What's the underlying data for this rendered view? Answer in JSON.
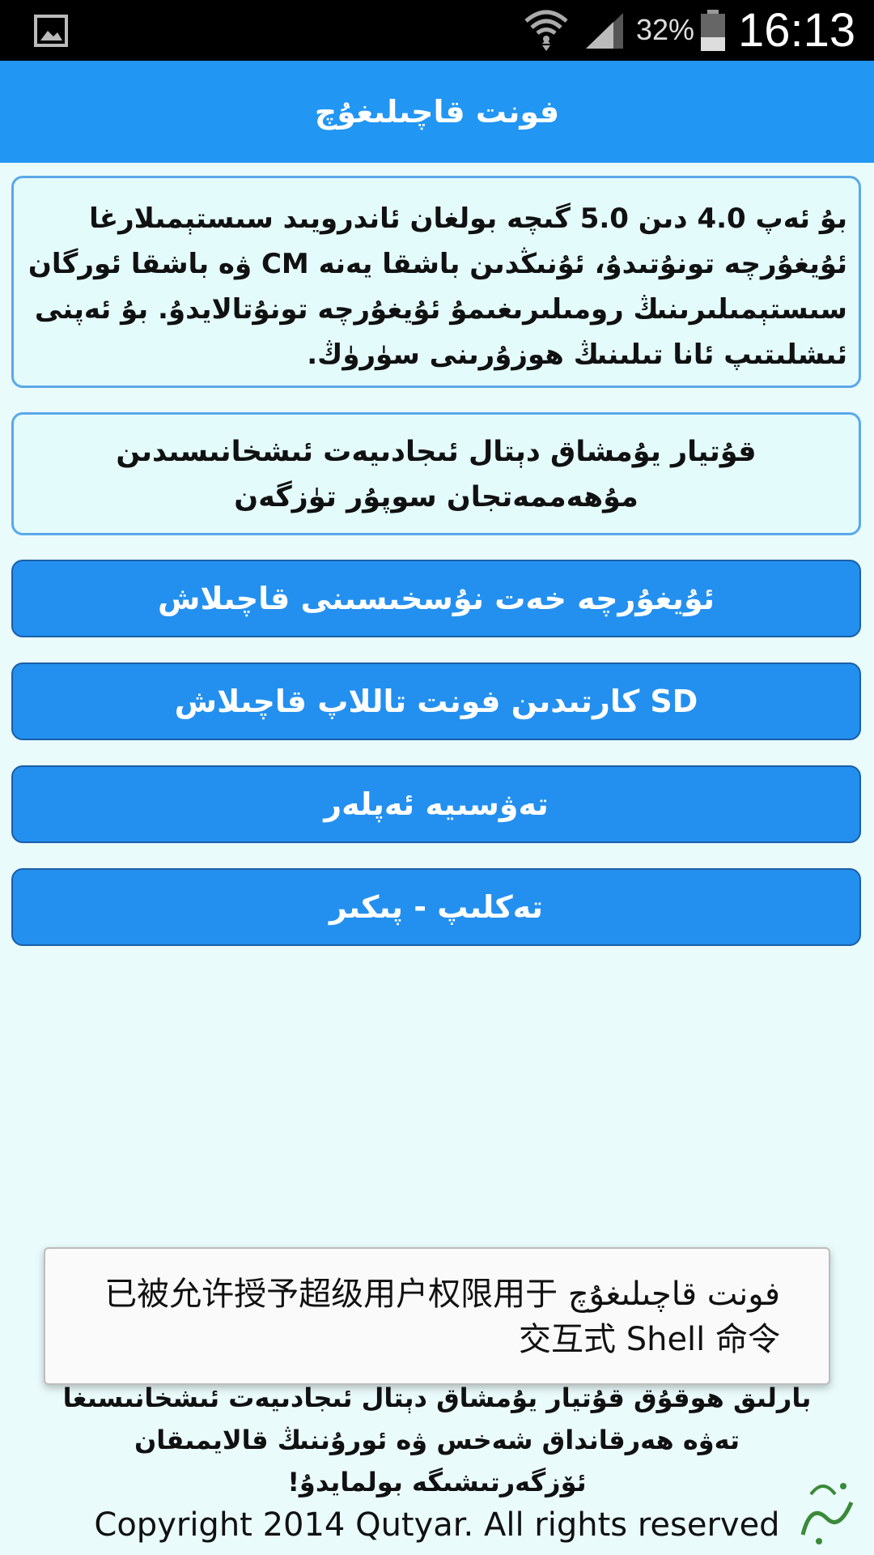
{
  "status_bar": {
    "battery_percent": "32%",
    "time": "16:13",
    "icons": [
      "gallery-icon",
      "wifi-icon",
      "signal-icon",
      "battery-icon"
    ]
  },
  "app_bar": {
    "title": "فونت قاچىلىغۇچ"
  },
  "description": "بۇ ئەپ 4.0 دىن 5.0 گىچە بولغان ئاندرويىد سىستېمىلارغا ئۇيغۇرچە تونۇتىدۇ، ئۇنىڭدىن باشقا يەنە CM ۋە باشقا ئورگان سىستېمىلىرىنىڭ رومىلىرىغىمۇ ئۇيغۇرچە تونۇتالايدۇ. بۇ ئەپنى ئىشلىتىپ ئانا تىلىنىڭ ھوزۇرىنى سۈرۈڭ.",
  "author_note": "قۇتيار يۇمشاق دېتال ئىجادىيەت ئىشخانىسىدىن مۇھەممەتجان سوپۇر تۈزگەن",
  "buttons": {
    "install_font": "ئۇيغۇرچە خەت نۇسخىسىنى قاچىلاش",
    "sd_card": "SD كارتىدىن فونت تاللاپ قاچىلاش",
    "recommended_apps": "تەۋسىيە ئەپلەر",
    "feedback": "تەكلىپ - پىكىر"
  },
  "toast": {
    "message": "فونت قاچىلىغۇچ 已被允许授予超级用户权限用于交互式 Shell 命令"
  },
  "footer": {
    "rights_text": "بارلىق ھوقۇق قۇتيار يۇمشاق دېتال ئىجادىيەت ئىشخانىسىغا تەۋە ھەرقانداق شەخس ۋە ئورۇننىڭ قالايمىقان ئۆزگەرتىشىگە بولمايدۇ!",
    "copyright": "Copyright 2014 Qutyar. All rights reserved",
    "link": "www.Qutyar.net"
  },
  "colors": {
    "accent": "#2196f3",
    "background": "#eafbfb",
    "button": "#2390ef",
    "card_border": "#5aa8ea",
    "link": "#6262e0"
  }
}
